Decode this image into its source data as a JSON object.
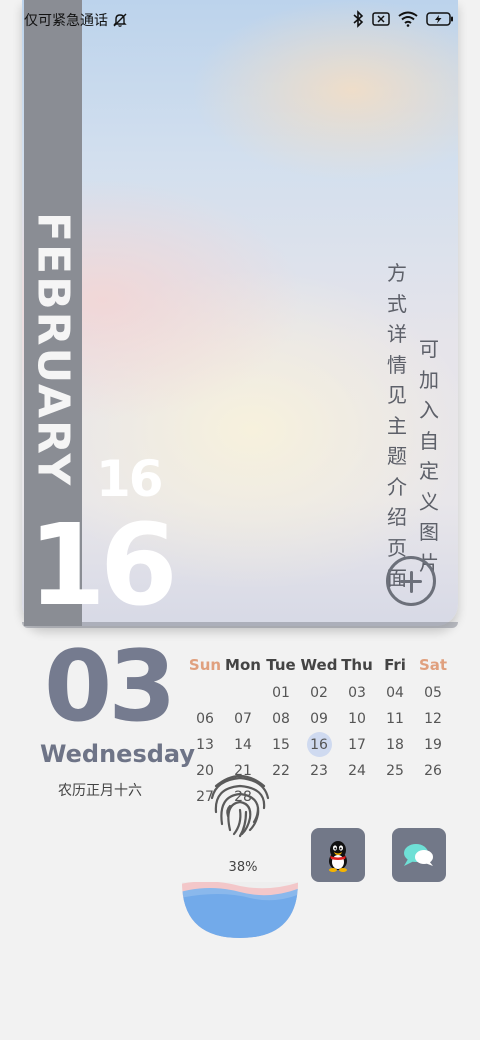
{
  "status_bar": {
    "carrier": "仅可紧急通话"
  },
  "card": {
    "month": "FEBRUARY",
    "day_small": "16",
    "day_big": "16",
    "hint_col1": "方式详情见主题介绍页面",
    "hint_col2": "可加入自定义图片"
  },
  "widget": {
    "date": "03",
    "weekday": "Wednesday",
    "lunar": "农历正月十六"
  },
  "calendar": {
    "headers": [
      "Sun",
      "Mon",
      "Tue",
      "Wed",
      "Thu",
      "Fri",
      "Sat"
    ],
    "weeks": [
      [
        "",
        "",
        "01",
        "02",
        "03",
        "04",
        "05"
      ],
      [
        "06",
        "07",
        "08",
        "09",
        "10",
        "11",
        "12"
      ],
      [
        "13",
        "14",
        "15",
        "16",
        "17",
        "18",
        "19"
      ],
      [
        "20",
        "21",
        "22",
        "23",
        "24",
        "25",
        "26"
      ],
      [
        "27",
        "28",
        "",
        "",
        "",
        "",
        ""
      ]
    ],
    "highlighted": "16",
    "weekend_color": "#e0a07e",
    "today_color": "#cfdaf0"
  },
  "apps": [
    {
      "name": "qq-icon"
    },
    {
      "name": "message-icon"
    }
  ],
  "battery": {
    "label": "38%",
    "level": 0.38
  },
  "colors": {
    "accent": "#757b8f",
    "strip": "#8a8d94",
    "app_tile": "#727888"
  }
}
